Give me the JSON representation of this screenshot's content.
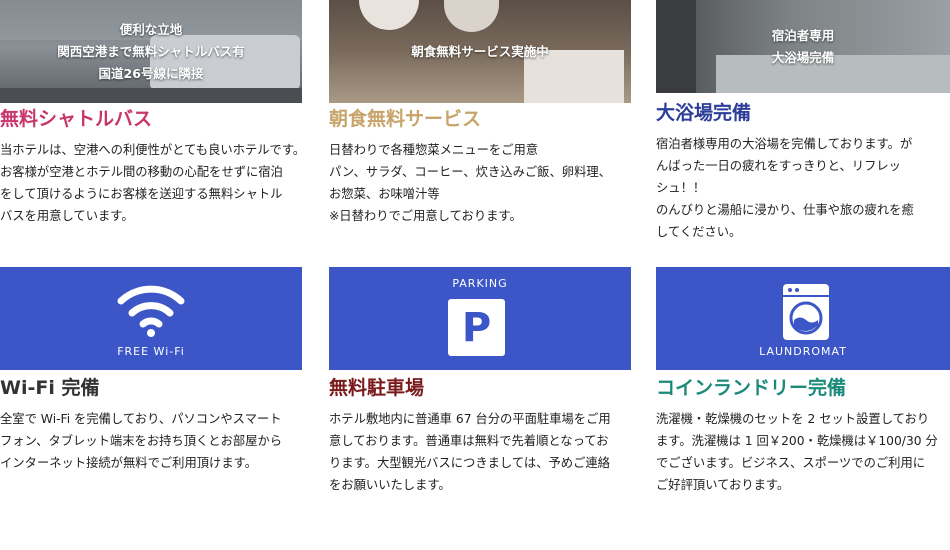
{
  "colors": {
    "shuttle_title": "#c8356a",
    "breakfast_title": "#c7a46a",
    "bath_title": "#2c3e9a",
    "wifi_title": "#333333",
    "parking_title": "#7a1a1a",
    "laundry_title": "#1a8a7a",
    "panel_blue": "#3c56c7"
  },
  "shuttle": {
    "caption": [
      "便利な立地",
      "関西空港まで無料シャトルバス有",
      "国道26号線に隣接"
    ],
    "title": "無料シャトルバス",
    "body": [
      "当ホテルは、空港への利便性がとても良いホテルです。",
      "お客様が空港とホテル間の移動の心配をせずに宿泊",
      "をして頂けるようにお客様を送迎する無料シャトル",
      "バスを用意しています。"
    ]
  },
  "breakfast": {
    "caption": [
      "朝食無料サービス実施中"
    ],
    "title": "朝食無料サービス",
    "body": [
      "日替わりで各種惣菜メニューをご用意",
      "パン、サラダ、コーヒー、炊き込みご飯、卵料理、",
      "お惣菜、お味噌汁等",
      "※日替わりでご用意しております。"
    ]
  },
  "bath": {
    "caption": [
      "宿泊者専用",
      "大浴場完備"
    ],
    "title": "大浴場完備",
    "body": [
      "宿泊者様専用の大浴場を完備しております。が",
      "んばった一日の疲れをすっきりと、リフレッ",
      "シュ！！",
      "のんびりと湯船に浸かり、仕事や旅の疲れを癒",
      "してください。"
    ]
  },
  "wifi": {
    "icon_label": "FREE Wi-Fi",
    "icon": "wifi-icon",
    "title": "Wi-Fi 完備",
    "body": [
      "全室で Wi-Fi を完備しており、パソコンやスマート",
      "フォン、タブレット端末をお持ち頂くとお部屋から",
      "インターネット接続が無料でご利用頂けます。"
    ]
  },
  "parking": {
    "icon_label": "PARKING",
    "icon_letter": "P",
    "icon": "parking-icon",
    "title": "無料駐車場",
    "body": [
      "ホテル敷地内に普通車 67 台分の平面駐車場をご用",
      "意しております。普通車は無料で先着順となってお",
      "ります。大型観光バスにつきましては、予めご連絡",
      "をお願いいたします。"
    ]
  },
  "laundry": {
    "icon_label": "LAUNDROMAT",
    "icon": "washing-machine-icon",
    "title": "コインランドリー完備",
    "body": [
      "洗濯機・乾燥機のセットを 2 セット設置しており",
      "ます。洗濯機は 1 回￥200・乾燥機は￥100/30 分",
      "でございます。ビジネス、スポーツでのご利用に",
      "ご好評頂いております。"
    ]
  }
}
